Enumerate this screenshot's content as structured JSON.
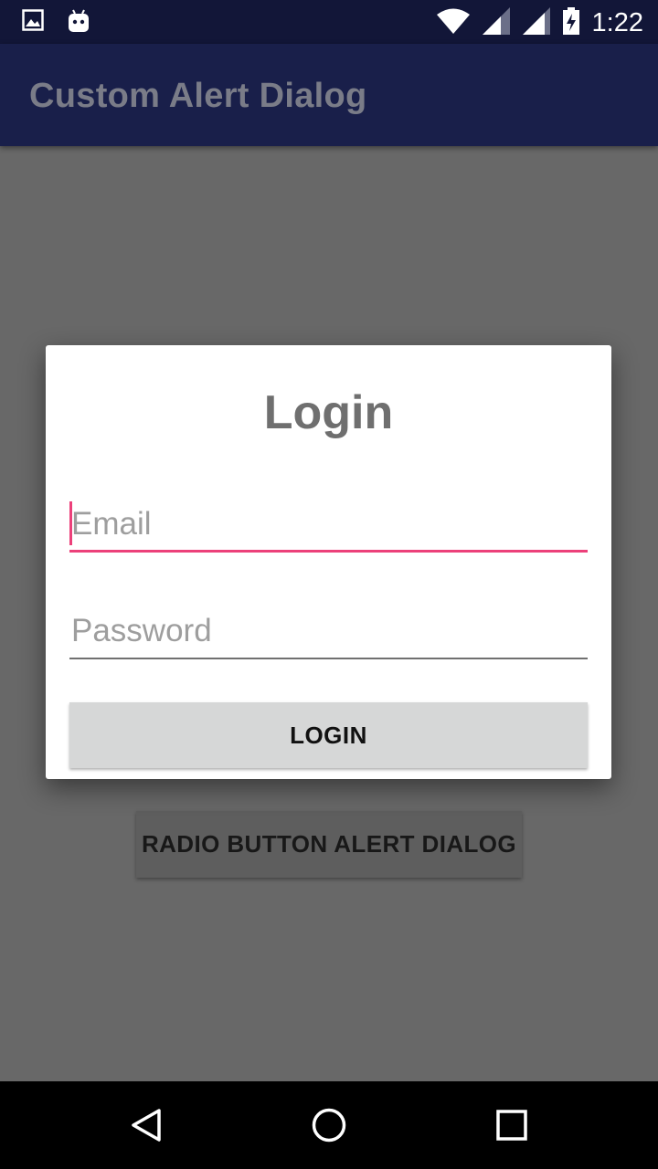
{
  "status_bar": {
    "time": "1:22",
    "icons": [
      "image-icon",
      "android-icon",
      "wifi-icon",
      "signal-icon",
      "signal-icon",
      "battery-charging-icon"
    ]
  },
  "app_bar": {
    "title": "Custom Alert Dialog"
  },
  "background_button": {
    "label": "RADIO BUTTON ALERT DIALOG"
  },
  "dialog": {
    "title": "Login",
    "email": {
      "value": "",
      "placeholder": "Email"
    },
    "password": {
      "value": "",
      "placeholder": "Password"
    },
    "login_label": "LOGIN"
  },
  "navigation": {
    "icons": [
      "back-icon",
      "home-icon",
      "recents-icon"
    ]
  },
  "colors": {
    "status_bar": "#121638",
    "app_bar": "#191f4a",
    "accent": "#ec407a",
    "scrim_background": "#686868",
    "dialog_button": "#d6d7d7"
  }
}
